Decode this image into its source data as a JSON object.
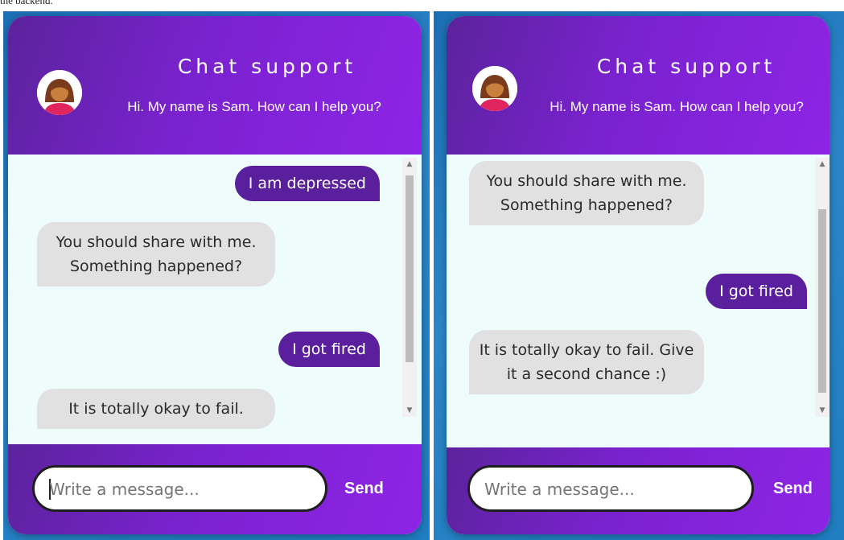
{
  "page": {
    "top_fragment": "the backend."
  },
  "chat_left": {
    "header": {
      "title": "Chat support",
      "subtitle": "Hi. My name is Sam. How can I help you?"
    },
    "messages": [
      {
        "from": "user",
        "text": "I am depressed"
      },
      {
        "from": "bot",
        "text": "You should share with me. Something happened?"
      },
      {
        "from": "user",
        "text": "I got fired"
      },
      {
        "from": "bot",
        "text": "It is totally okay to fail."
      }
    ],
    "input": {
      "placeholder": "Write a message..."
    },
    "send_label": "Send"
  },
  "chat_right": {
    "header": {
      "title": "Chat support",
      "subtitle": "Hi. My name is Sam. How can I help you?"
    },
    "messages": [
      {
        "from": "bot",
        "text": "You should share with me. Something happened?"
      },
      {
        "from": "user",
        "text": "I got fired"
      },
      {
        "from": "bot",
        "text": "It is totally okay to fail. Give it a second chance :)"
      }
    ],
    "input": {
      "placeholder": "Write a message..."
    },
    "send_label": "Send"
  },
  "colors": {
    "header_start": "#5b239c",
    "header_end": "#8e24e6",
    "user_bubble": "#5a1f9c",
    "bot_bubble": "#e1e1e1",
    "chat_bg": "#eefcfc"
  },
  "icons": {
    "avatar": "female-support-agent-avatar",
    "scroll_up": "scroll-up-arrow-icon",
    "scroll_down": "scroll-down-arrow-icon"
  }
}
